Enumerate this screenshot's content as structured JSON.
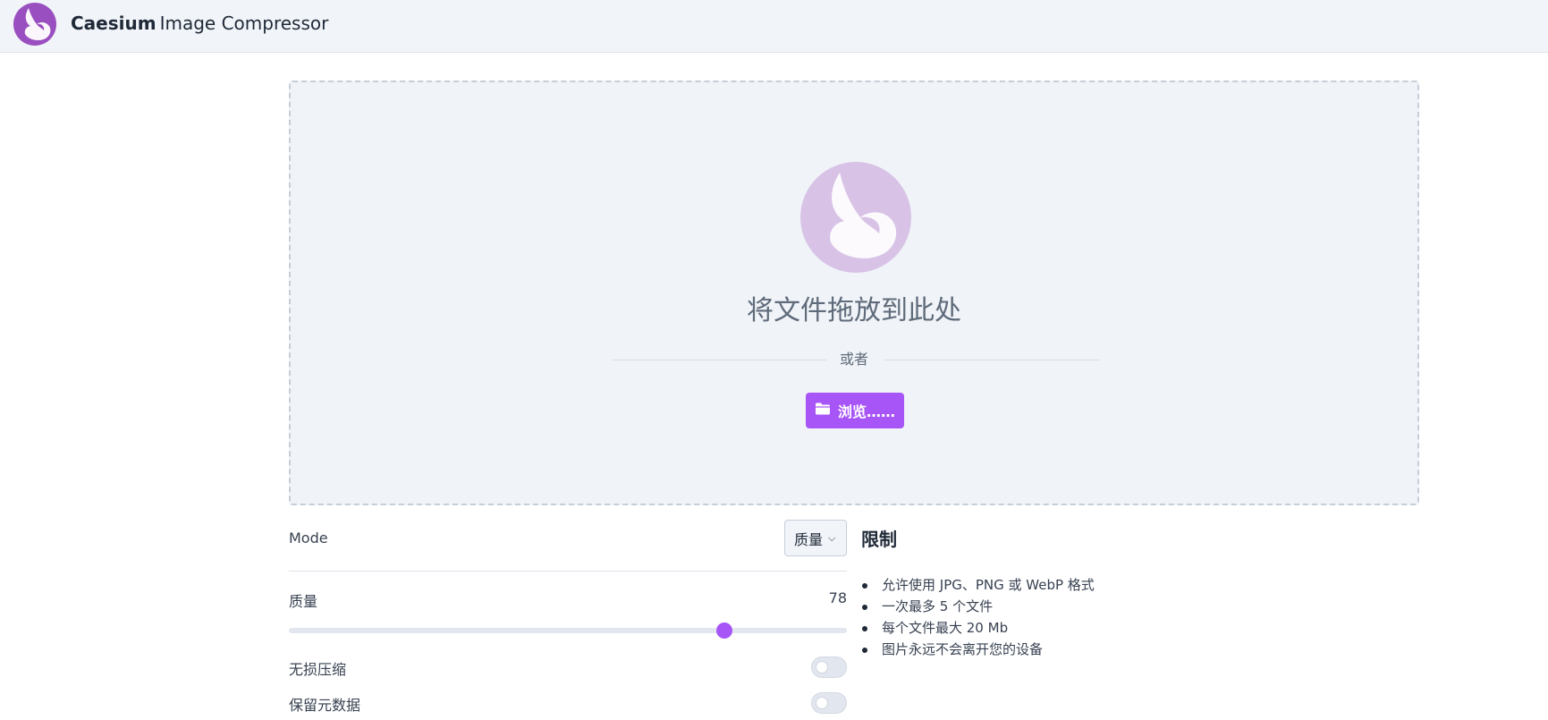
{
  "header": {
    "brand_bold": "Caesium",
    "brand_rest": "Image Compressor",
    "logo_icon": "caesium-bird-icon"
  },
  "dropzone": {
    "icon": "caesium-bird-icon",
    "title": "将文件拖放到此处",
    "or_text": "或者",
    "browse_label": "浏览……",
    "browse_icon": "folder-icon"
  },
  "settings": {
    "mode_label": "Mode",
    "mode_value": "质量",
    "quality_label": "质量",
    "quality_value": "78",
    "quality_fraction": 0.78,
    "lossless_label": "无损压缩",
    "lossless_on": false,
    "metadata_label": "保留元数据",
    "metadata_on": false
  },
  "limits": {
    "title": "限制",
    "items": [
      "允许使用 JPG、PNG 或 WebP 格式",
      "一次最多 5 个文件",
      "每个文件最大 20 Mb",
      "图片永远不会离开您的设备"
    ]
  },
  "colors": {
    "accent": "#a855f7",
    "logo_bg": "#9a4fc0",
    "drop_logo_bg": "#d8c3e7",
    "dropzone_bg": "#f0f3f8"
  }
}
